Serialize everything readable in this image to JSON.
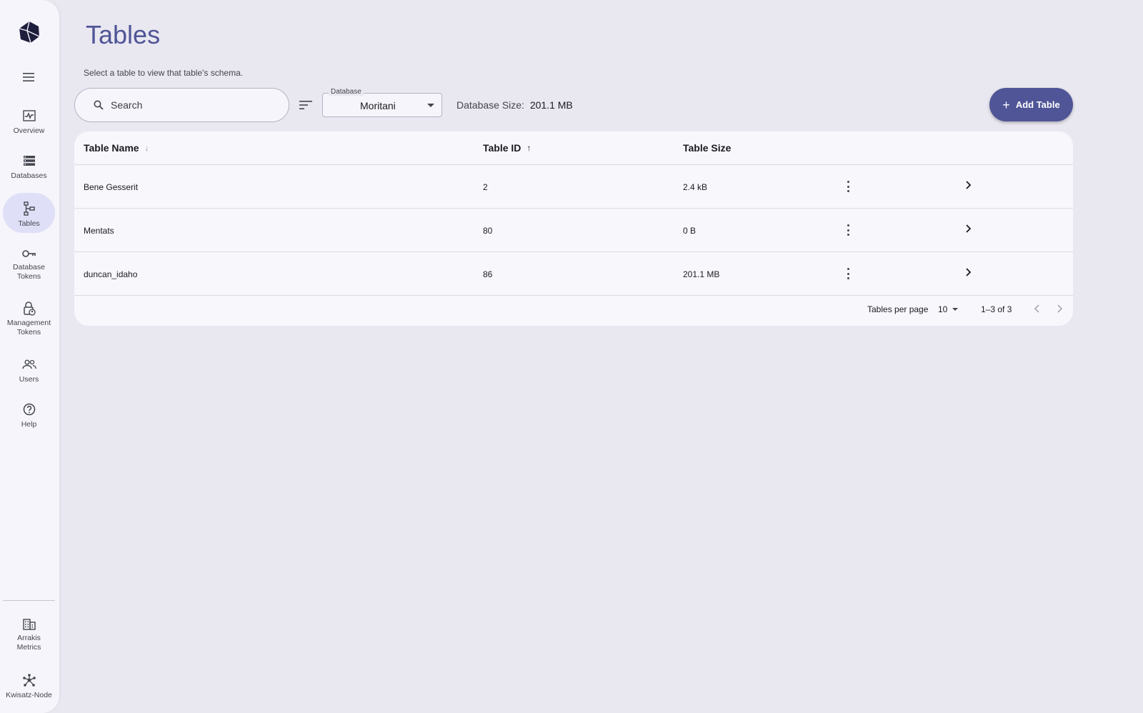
{
  "sidebar": {
    "logo_icon": "hexagon-logo-icon",
    "menu_icon": "hamburger-menu-icon",
    "items": [
      {
        "label": "Overview",
        "icon": "activity-chart-icon",
        "active": false
      },
      {
        "label": "Databases",
        "icon": "database-list-icon",
        "active": false
      },
      {
        "label": "Tables",
        "icon": "schema-tree-icon",
        "active": true
      },
      {
        "label": "Database\nTokens",
        "icon": "key-icon",
        "active": false
      },
      {
        "label": "Management\nTokens",
        "icon": "lock-person-icon",
        "active": false
      },
      {
        "label": "Users",
        "icon": "group-icon",
        "active": false
      },
      {
        "label": "Help",
        "icon": "help-circle-icon",
        "active": false
      }
    ],
    "bottom_items": [
      {
        "label": "Arrakis\nMetrics",
        "icon": "building-icon"
      },
      {
        "label": "Kwisatz-Node",
        "icon": "network-nodes-icon"
      }
    ]
  },
  "header": {
    "title": "Tables",
    "subtitle": "Select a table to view that table's schema."
  },
  "toolbar": {
    "search_placeholder": "Search",
    "filter_icon": "filter-list-icon",
    "database_label": "Database",
    "database_value": "Moritani",
    "db_size_label": "Database Size:",
    "db_size_value": "201.1 MB",
    "add_button_label": "Add Table"
  },
  "table": {
    "columns": [
      {
        "label": "Table Name",
        "sort": "↓"
      },
      {
        "label": "Table ID",
        "sort": "↑"
      },
      {
        "label": "Table Size",
        "sort": ""
      }
    ],
    "rows": [
      {
        "name": "Bene Gesserit",
        "id": "2",
        "size": "2.4 kB"
      },
      {
        "name": "Mentats",
        "id": "80",
        "size": "0 B"
      },
      {
        "name": "duncan_idaho",
        "id": "86",
        "size": "201.1 MB"
      }
    ],
    "footer": {
      "per_page_label": "Tables per page",
      "per_page_value": "10",
      "range": "1–3 of 3"
    }
  },
  "colors": {
    "accent": "#4f5596",
    "background": "#e9e7f0",
    "sidebar_active": "#dfe0f7"
  }
}
